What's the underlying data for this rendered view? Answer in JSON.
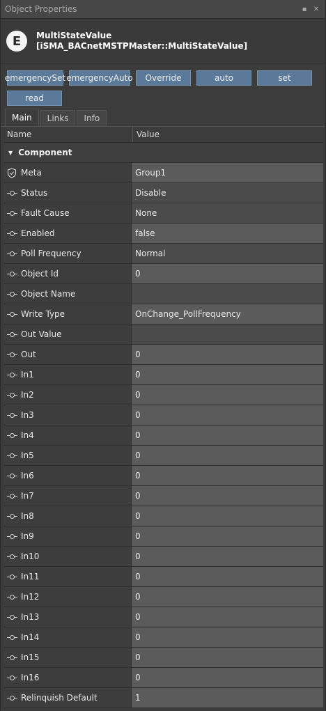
{
  "panel": {
    "title": "Object Properties"
  },
  "header": {
    "logo_letter": "E",
    "name": "MultiStateValue",
    "type": "[iSMA_BACnetMSTPMaster::MultiStateValue]"
  },
  "actions": [
    "emergencySet",
    "emergencyAuto",
    "Override",
    "auto",
    "set",
    "read"
  ],
  "tabs": [
    "Main",
    "Links",
    "Info"
  ],
  "grid": {
    "col_name": "Name",
    "col_value": "Value",
    "section": "Component",
    "rows": [
      {
        "name": "Meta",
        "value": "Group1"
      },
      {
        "name": "Status",
        "value": "Disable"
      },
      {
        "name": "Fault Cause",
        "value": "None"
      },
      {
        "name": "Enabled",
        "value": "false"
      },
      {
        "name": "Poll Frequency",
        "value": "Normal"
      },
      {
        "name": "Object Id",
        "value": "0"
      },
      {
        "name": "Object Name",
        "value": ""
      },
      {
        "name": "Write Type",
        "value": "OnChange_PollFrequency"
      },
      {
        "name": "Out Value",
        "value": ""
      },
      {
        "name": "Out",
        "value": "0"
      },
      {
        "name": "In1",
        "value": "0"
      },
      {
        "name": "In2",
        "value": "0"
      },
      {
        "name": "In3",
        "value": "0"
      },
      {
        "name": "In4",
        "value": "0"
      },
      {
        "name": "In5",
        "value": "0"
      },
      {
        "name": "In6",
        "value": "0"
      },
      {
        "name": "In7",
        "value": "0"
      },
      {
        "name": "In8",
        "value": "0"
      },
      {
        "name": "In9",
        "value": "0"
      },
      {
        "name": "In10",
        "value": "0"
      },
      {
        "name": "In11",
        "value": "0"
      },
      {
        "name": "In12",
        "value": "0"
      },
      {
        "name": "In13",
        "value": "0"
      },
      {
        "name": "In14",
        "value": "0"
      },
      {
        "name": "In15",
        "value": "0"
      },
      {
        "name": "In16",
        "value": "0"
      },
      {
        "name": "Relinquish Default",
        "value": "1"
      }
    ]
  }
}
